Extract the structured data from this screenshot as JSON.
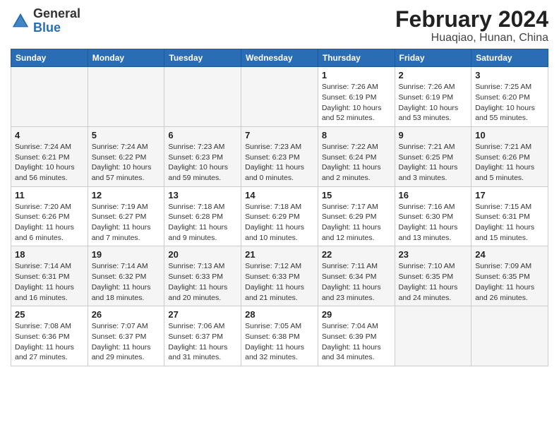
{
  "title": "February 2024",
  "subtitle": "Huaqiao, Hunan, China",
  "logo": {
    "general": "General",
    "blue": "Blue"
  },
  "weekdays": [
    "Sunday",
    "Monday",
    "Tuesday",
    "Wednesday",
    "Thursday",
    "Friday",
    "Saturday"
  ],
  "weeks": [
    [
      {
        "day": "",
        "info": ""
      },
      {
        "day": "",
        "info": ""
      },
      {
        "day": "",
        "info": ""
      },
      {
        "day": "",
        "info": ""
      },
      {
        "day": "1",
        "info": "Sunrise: 7:26 AM\nSunset: 6:19 PM\nDaylight: 10 hours\nand 52 minutes."
      },
      {
        "day": "2",
        "info": "Sunrise: 7:26 AM\nSunset: 6:19 PM\nDaylight: 10 hours\nand 53 minutes."
      },
      {
        "day": "3",
        "info": "Sunrise: 7:25 AM\nSunset: 6:20 PM\nDaylight: 10 hours\nand 55 minutes."
      }
    ],
    [
      {
        "day": "4",
        "info": "Sunrise: 7:24 AM\nSunset: 6:21 PM\nDaylight: 10 hours\nand 56 minutes."
      },
      {
        "day": "5",
        "info": "Sunrise: 7:24 AM\nSunset: 6:22 PM\nDaylight: 10 hours\nand 57 minutes."
      },
      {
        "day": "6",
        "info": "Sunrise: 7:23 AM\nSunset: 6:23 PM\nDaylight: 10 hours\nand 59 minutes."
      },
      {
        "day": "7",
        "info": "Sunrise: 7:23 AM\nSunset: 6:23 PM\nDaylight: 11 hours\nand 0 minutes."
      },
      {
        "day": "8",
        "info": "Sunrise: 7:22 AM\nSunset: 6:24 PM\nDaylight: 11 hours\nand 2 minutes."
      },
      {
        "day": "9",
        "info": "Sunrise: 7:21 AM\nSunset: 6:25 PM\nDaylight: 11 hours\nand 3 minutes."
      },
      {
        "day": "10",
        "info": "Sunrise: 7:21 AM\nSunset: 6:26 PM\nDaylight: 11 hours\nand 5 minutes."
      }
    ],
    [
      {
        "day": "11",
        "info": "Sunrise: 7:20 AM\nSunset: 6:26 PM\nDaylight: 11 hours\nand 6 minutes."
      },
      {
        "day": "12",
        "info": "Sunrise: 7:19 AM\nSunset: 6:27 PM\nDaylight: 11 hours\nand 7 minutes."
      },
      {
        "day": "13",
        "info": "Sunrise: 7:18 AM\nSunset: 6:28 PM\nDaylight: 11 hours\nand 9 minutes."
      },
      {
        "day": "14",
        "info": "Sunrise: 7:18 AM\nSunset: 6:29 PM\nDaylight: 11 hours\nand 10 minutes."
      },
      {
        "day": "15",
        "info": "Sunrise: 7:17 AM\nSunset: 6:29 PM\nDaylight: 11 hours\nand 12 minutes."
      },
      {
        "day": "16",
        "info": "Sunrise: 7:16 AM\nSunset: 6:30 PM\nDaylight: 11 hours\nand 13 minutes."
      },
      {
        "day": "17",
        "info": "Sunrise: 7:15 AM\nSunset: 6:31 PM\nDaylight: 11 hours\nand 15 minutes."
      }
    ],
    [
      {
        "day": "18",
        "info": "Sunrise: 7:14 AM\nSunset: 6:31 PM\nDaylight: 11 hours\nand 16 minutes."
      },
      {
        "day": "19",
        "info": "Sunrise: 7:14 AM\nSunset: 6:32 PM\nDaylight: 11 hours\nand 18 minutes."
      },
      {
        "day": "20",
        "info": "Sunrise: 7:13 AM\nSunset: 6:33 PM\nDaylight: 11 hours\nand 20 minutes."
      },
      {
        "day": "21",
        "info": "Sunrise: 7:12 AM\nSunset: 6:33 PM\nDaylight: 11 hours\nand 21 minutes."
      },
      {
        "day": "22",
        "info": "Sunrise: 7:11 AM\nSunset: 6:34 PM\nDaylight: 11 hours\nand 23 minutes."
      },
      {
        "day": "23",
        "info": "Sunrise: 7:10 AM\nSunset: 6:35 PM\nDaylight: 11 hours\nand 24 minutes."
      },
      {
        "day": "24",
        "info": "Sunrise: 7:09 AM\nSunset: 6:35 PM\nDaylight: 11 hours\nand 26 minutes."
      }
    ],
    [
      {
        "day": "25",
        "info": "Sunrise: 7:08 AM\nSunset: 6:36 PM\nDaylight: 11 hours\nand 27 minutes."
      },
      {
        "day": "26",
        "info": "Sunrise: 7:07 AM\nSunset: 6:37 PM\nDaylight: 11 hours\nand 29 minutes."
      },
      {
        "day": "27",
        "info": "Sunrise: 7:06 AM\nSunset: 6:37 PM\nDaylight: 11 hours\nand 31 minutes."
      },
      {
        "day": "28",
        "info": "Sunrise: 7:05 AM\nSunset: 6:38 PM\nDaylight: 11 hours\nand 32 minutes."
      },
      {
        "day": "29",
        "info": "Sunrise: 7:04 AM\nSunset: 6:39 PM\nDaylight: 11 hours\nand 34 minutes."
      },
      {
        "day": "",
        "info": ""
      },
      {
        "day": "",
        "info": ""
      }
    ]
  ]
}
